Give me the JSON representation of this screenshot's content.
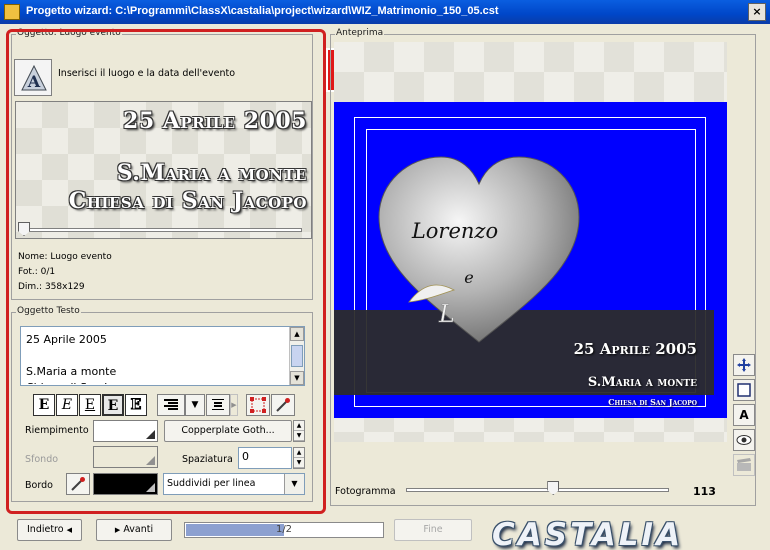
{
  "window": {
    "title": "Progetto wizard: C:\\Programmi\\ClassX\\castalia\\project\\wizard\\WIZ_Matrimonio_150_05.cst",
    "close_glyph": "×"
  },
  "object_panel": {
    "legend": "Oggetto: Luogo evento",
    "description": "Inserisci il luogo e la data dell'evento",
    "preview_lines": [
      "25 Aprile 2005",
      "S.Maria a monte",
      "Chiesa di San Jacopo"
    ],
    "slider_value": 0,
    "info": {
      "nome": "Nome: Luogo evento",
      "fot": "Fot.: 0/1",
      "dim": "Dim.: 358x129"
    }
  },
  "text_panel": {
    "legend": "Oggetto Testo",
    "text_content": "25 Aprile 2005\n\nS.Maria a monte\nChiesa di San Jacopo",
    "format_buttons": [
      "E",
      "E",
      "E",
      "E",
      "E"
    ],
    "labels": {
      "riempimento": "Riempimento",
      "sfondo": "Sfondo",
      "spaziatura": "Spaziatura",
      "bordo": "Bordo"
    },
    "font_name": "Copperplate Goth...",
    "spacing_value": "0",
    "split_option": "Suddividi per linea",
    "colors": {
      "fill": "#ffffff",
      "background": "#ece9d8",
      "border": "#000000"
    }
  },
  "step_badge": "1",
  "preview_panel": {
    "legend": "Anteprima",
    "names": {
      "first": "Lorenzo",
      "and": "e",
      "initial": "L"
    },
    "band_lines": [
      "25 Aprile 2005",
      "S.Maria a monte",
      "Chiesa di San Jacopo"
    ],
    "frame_label": "Fotogramma",
    "frame_value": "113",
    "frame_fraction": 0.56,
    "background_color": "#0000ff"
  },
  "side_tools": [
    "move-icon",
    "select-icon",
    "text-icon",
    "eye-icon",
    "clapper-icon"
  ],
  "navigation": {
    "back_label": "Indietro",
    "next_label": "Avanti",
    "progress_text": "1/2",
    "progress_fraction": 0.5,
    "finish_label": "Fine"
  },
  "logo_text": "CASTALIA"
}
